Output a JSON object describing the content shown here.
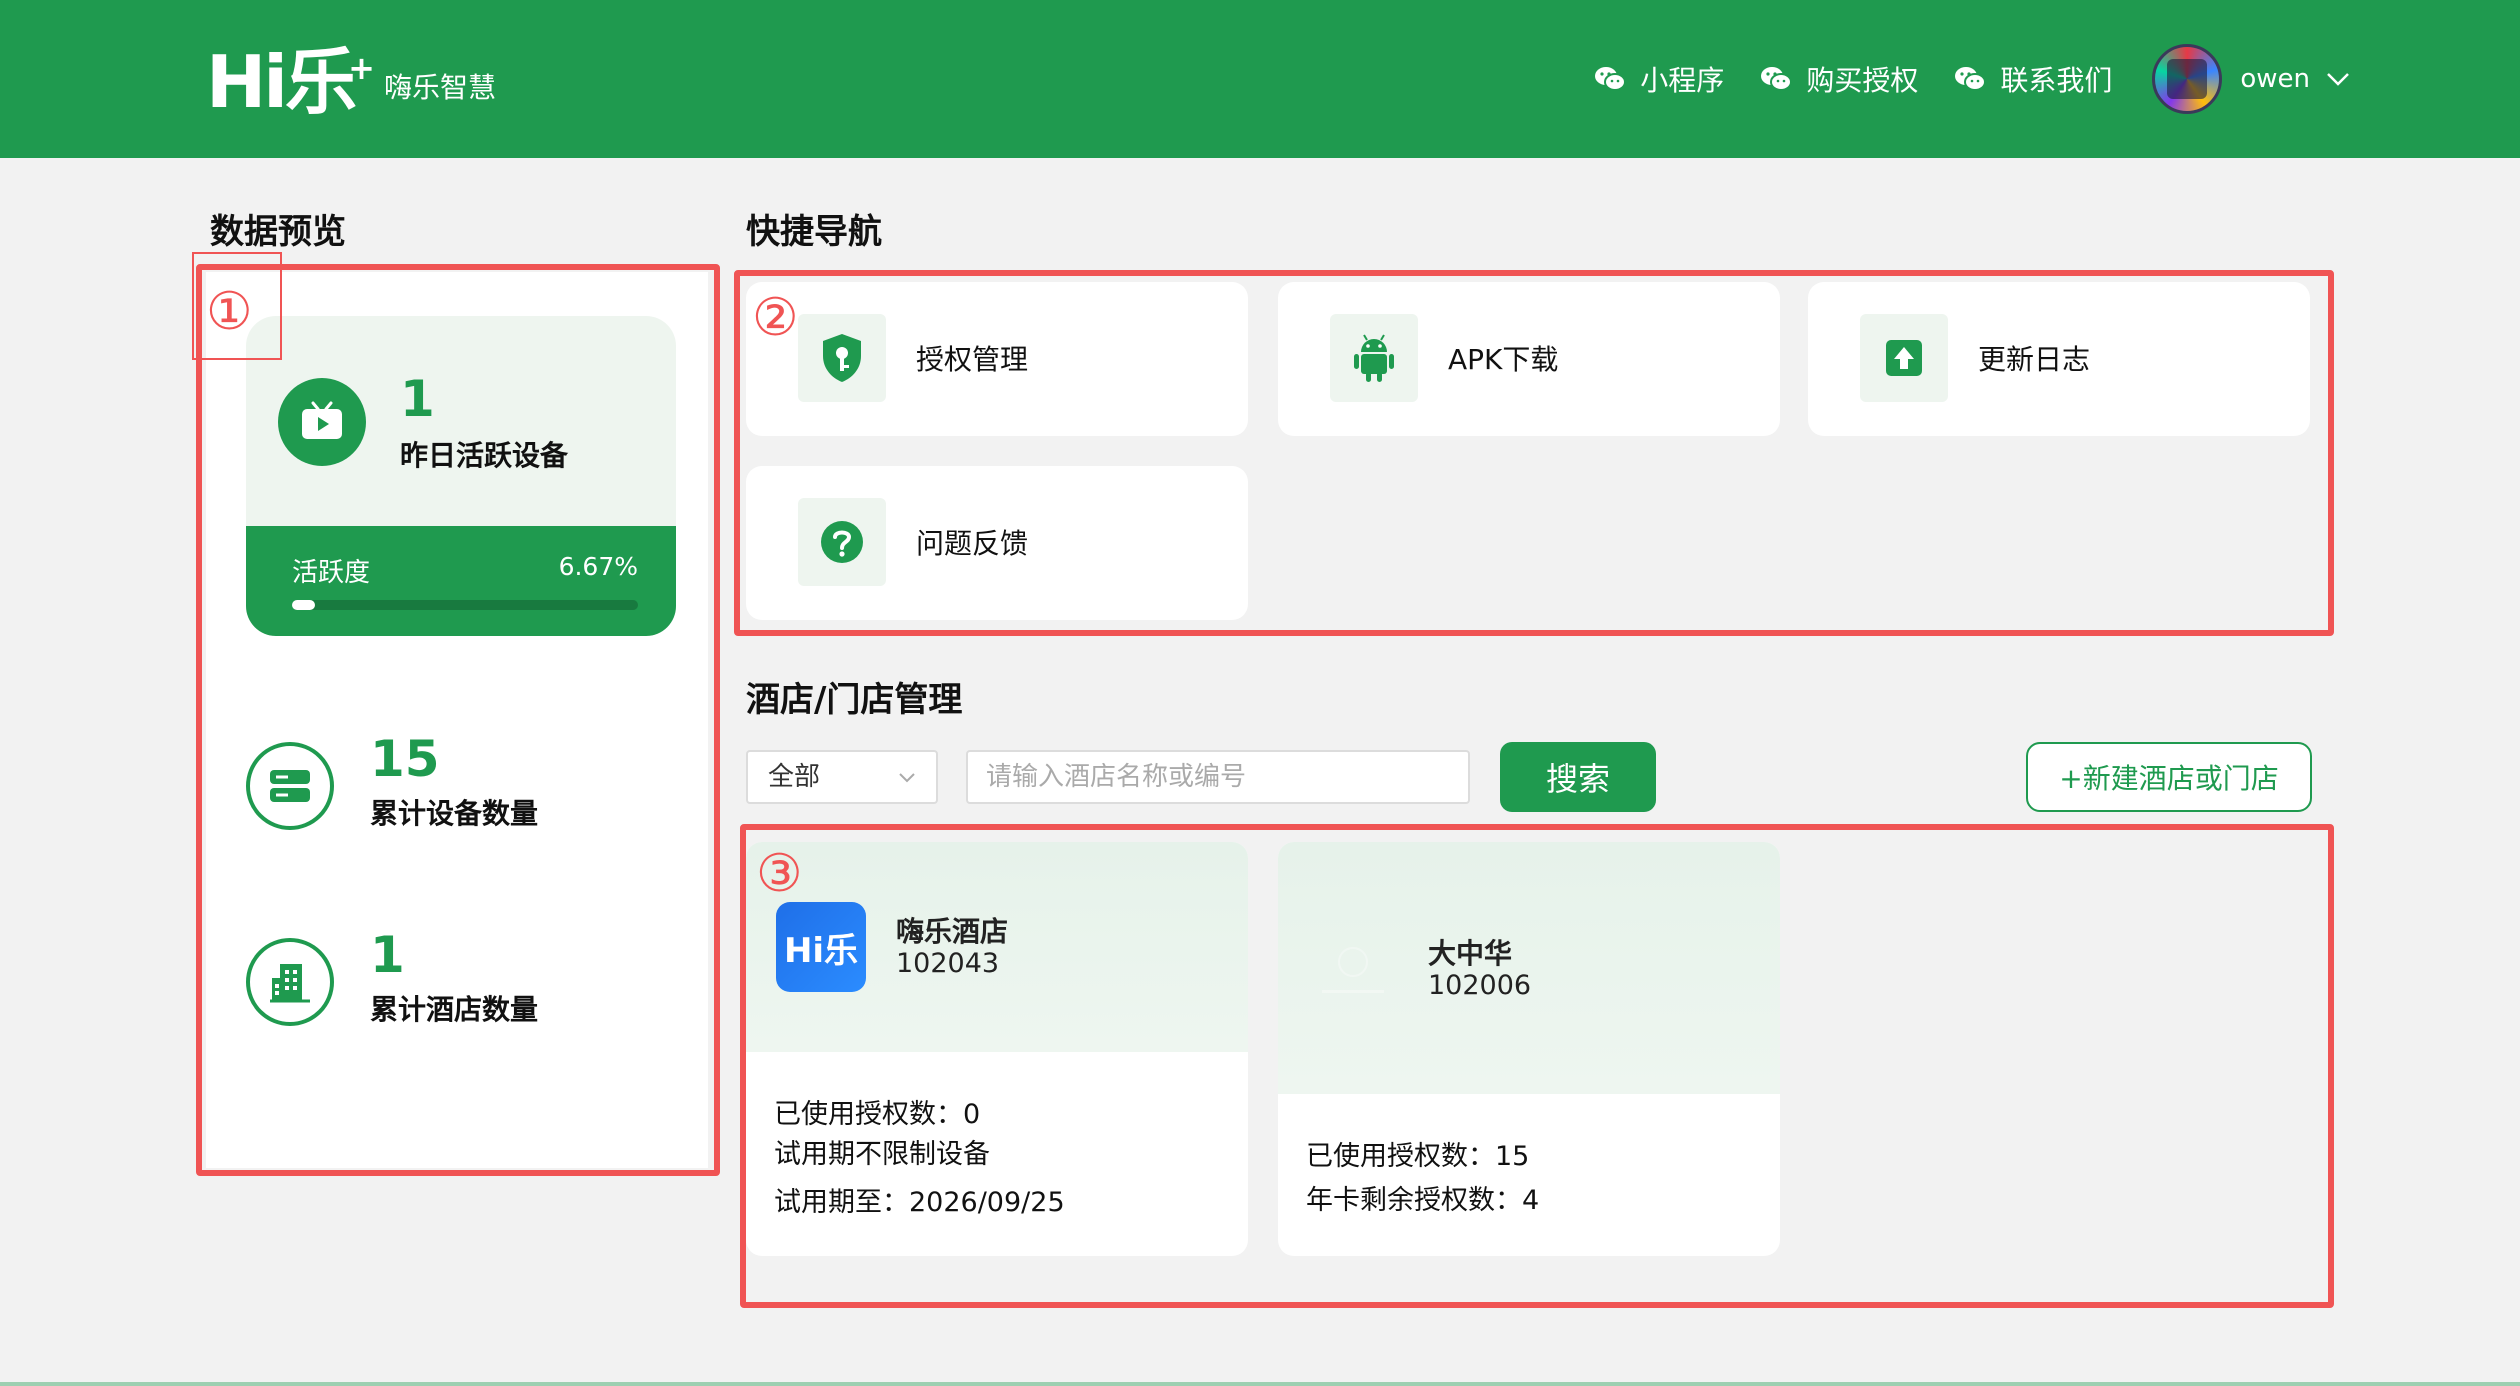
{
  "header": {
    "logo_mark": "Hi乐",
    "logo_plus": "+",
    "brand_name": "嗨乐智慧",
    "nav": [
      {
        "label": "小程序"
      },
      {
        "label": "购买授权"
      },
      {
        "label": "联系我们"
      }
    ],
    "username": "owen"
  },
  "overview": {
    "title": "数据预览",
    "active": {
      "value": "1",
      "label": "昨日活跃设备",
      "activity_label": "活跃度",
      "activity_pct": "6.67%",
      "activity_fraction": 0.0667
    },
    "devices": {
      "value": "15",
      "label": "累计设备数量"
    },
    "hotels": {
      "value": "1",
      "label": "累计酒店数量"
    }
  },
  "quicknav": {
    "title": "快捷导航",
    "items": [
      {
        "label": "授权管理",
        "icon": "shield-key-icon"
      },
      {
        "label": "APK下载",
        "icon": "android-icon"
      },
      {
        "label": "更新日志",
        "icon": "upload-icon"
      },
      {
        "label": "问题反馈",
        "icon": "question-icon"
      }
    ]
  },
  "hotel_mgmt": {
    "title": "酒店/门店管理",
    "filter_value": "全部",
    "search_placeholder": "请输入酒店名称或编号",
    "search_label": "搜索",
    "new_label": "+新建酒店或门店",
    "hotels": [
      {
        "name": "嗨乐酒店",
        "code": "102043",
        "logo_text": "Hi乐",
        "lines": [
          "已使用授权数：0",
          "试用期不限制设备",
          "试用期至：2026/09/25"
        ]
      },
      {
        "name": "大中华",
        "code": "102006",
        "lines": [
          "已使用授权数：15",
          "年卡剩余授权数：4"
        ]
      }
    ]
  },
  "annotations": {
    "one": "①",
    "two": "②",
    "three": "③"
  },
  "colors": {
    "brand": "#1f9a4f",
    "annotation": "#f05454"
  }
}
